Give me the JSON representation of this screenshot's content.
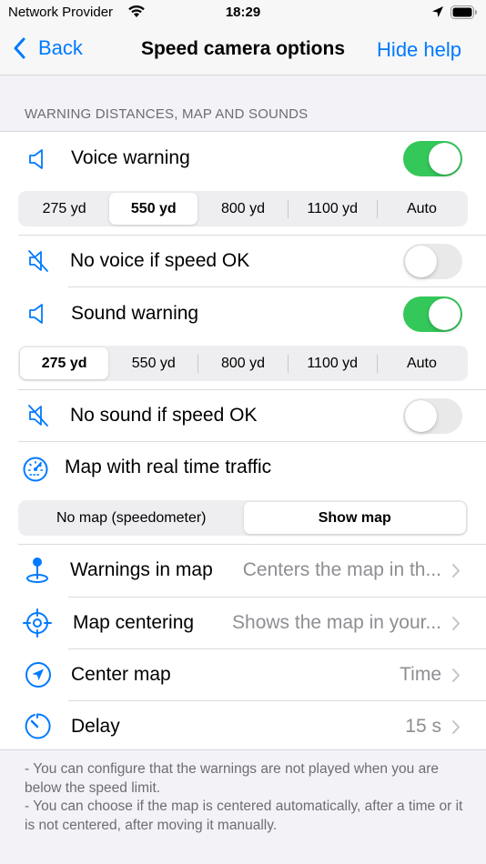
{
  "status": {
    "carrier": "Network Provider",
    "time": "18:29"
  },
  "nav": {
    "back": "Back",
    "title": "Speed camera options",
    "right": "Hide help"
  },
  "section_header": "WARNING DISTANCES, MAP AND SOUNDS",
  "voice_warning": {
    "label": "Voice warning",
    "on": true
  },
  "voice_distances": [
    "275 yd",
    "550 yd",
    "800 yd",
    "1100 yd",
    "Auto"
  ],
  "voice_selected": "550 yd",
  "no_voice": {
    "label": "No voice if speed OK",
    "on": false
  },
  "sound_warning": {
    "label": "Sound warning",
    "on": true
  },
  "sound_distances": [
    "275 yd",
    "550 yd",
    "800 yd",
    "1100 yd",
    "Auto"
  ],
  "sound_selected": "275 yd",
  "no_sound": {
    "label": "No sound if speed OK",
    "on": false
  },
  "map_traffic": {
    "label": "Map with real time traffic"
  },
  "map_options": [
    "No map (speedometer)",
    "Show map"
  ],
  "map_selected": "Show map",
  "warnings_in_map": {
    "label": "Warnings in map",
    "value": "Centers the map in th..."
  },
  "map_centering": {
    "label": "Map centering",
    "value": "Shows the map in your..."
  },
  "center_map": {
    "label": "Center map",
    "value": "Time"
  },
  "delay": {
    "label": "Delay",
    "value": "15 s"
  },
  "footer": {
    "line1": "- You can configure that the warnings are not played when you are below the speed limit.",
    "line2": "- You can choose if the map is centered automatically, after a time or it is not centered, after moving it manually."
  },
  "colors": {
    "accent": "#007aff",
    "toggle_on": "#34c759",
    "toggle_off": "#e9e9ea",
    "secondary_text": "#8e8e93",
    "background": "#f2f2f7"
  },
  "icons": {
    "voice": "speaker-icon",
    "no_voice": "speaker-muted-icon",
    "map": "speedometer-icon",
    "warnings_in_map": "map-pin-icon",
    "centering": "crosshair-icon",
    "center_map": "location-arrow-icon",
    "delay": "timer-icon"
  }
}
